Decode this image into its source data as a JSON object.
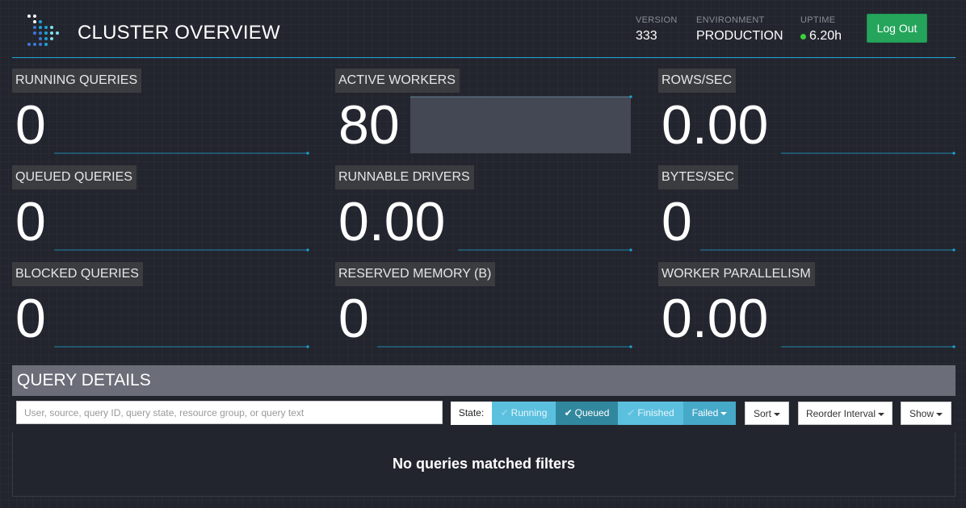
{
  "header": {
    "title": "CLUSTER OVERVIEW",
    "version_label": "VERSION",
    "version_value": "333",
    "environment_label": "ENVIRONMENT",
    "environment_value": "PRODUCTION",
    "uptime_label": "UPTIME",
    "uptime_value": "6.20h",
    "logout_label": "Log Out",
    "uptime_dot_color": "#3bd23b"
  },
  "metrics": [
    {
      "label": "RUNNING QUERIES",
      "value": "0"
    },
    {
      "label": "ACTIVE WORKERS",
      "value": "80"
    },
    {
      "label": "ROWS/SEC",
      "value": "0.00"
    },
    {
      "label": "QUEUED QUERIES",
      "value": "0"
    },
    {
      "label": "RUNNABLE DRIVERS",
      "value": "0.00"
    },
    {
      "label": "BYTES/SEC",
      "value": "0"
    },
    {
      "label": "BLOCKED QUERIES",
      "value": "0"
    },
    {
      "label": "RESERVED MEMORY (B)",
      "value": "0"
    },
    {
      "label": "WORKER PARALLELISM",
      "value": "0.00"
    }
  ],
  "query_details": {
    "title": "QUERY DETAILS",
    "search_placeholder": "User, source, query ID, query state, resource group, or query text",
    "state_label": "State:",
    "filters": {
      "running": "Running",
      "queued": "Queued",
      "finished": "Finished",
      "failed": "Failed"
    },
    "sort_label": "Sort",
    "reorder_label": "Reorder Interval",
    "show_label": "Show",
    "empty_message": "No queries matched filters"
  },
  "colors": {
    "accent": "#1aa6d6",
    "logout": "#25a55b",
    "filter_active": "#31889e",
    "filter_inactive": "#5bc0de"
  }
}
